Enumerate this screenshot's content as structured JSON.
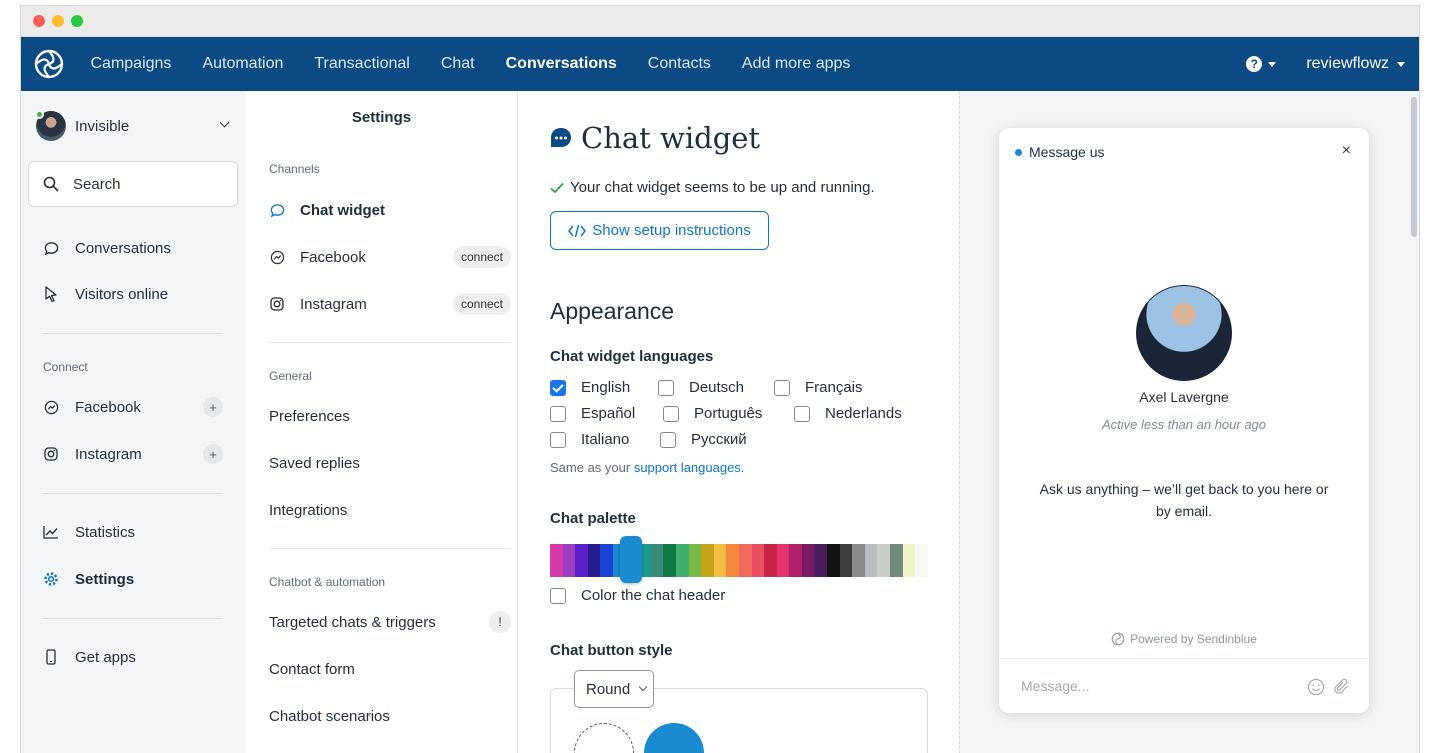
{
  "topnav": {
    "items": [
      {
        "label": "Campaigns",
        "active": false
      },
      {
        "label": "Automation",
        "active": false
      },
      {
        "label": "Transactional",
        "active": false
      },
      {
        "label": "Chat",
        "active": false
      },
      {
        "label": "Conversations",
        "active": true
      },
      {
        "label": "Contacts",
        "active": false
      },
      {
        "label": "Add more apps",
        "active": false
      }
    ],
    "help_symbol": "?",
    "account": "reviewflowz"
  },
  "sidebar": {
    "user_status": "Invisible",
    "search_label": "Search",
    "items": [
      {
        "label": "Conversations",
        "icon": "chat-bubble-icon"
      },
      {
        "label": "Visitors online",
        "icon": "cursor-icon"
      }
    ],
    "connect_section": "Connect",
    "connect_items": [
      {
        "label": "Facebook",
        "icon": "messenger-icon",
        "action": "+"
      },
      {
        "label": "Instagram",
        "icon": "instagram-icon",
        "action": "+"
      }
    ],
    "bottom_items": [
      {
        "label": "Statistics",
        "icon": "chart-icon"
      },
      {
        "label": "Settings",
        "icon": "gear-icon",
        "active": true
      }
    ],
    "get_apps": "Get apps"
  },
  "settings": {
    "title": "Settings",
    "channels_section": "Channels",
    "channels": [
      {
        "label": "Chat widget",
        "active": true
      },
      {
        "label": "Facebook",
        "badge": "connect"
      },
      {
        "label": "Instagram",
        "badge": "connect"
      }
    ],
    "general_section": "General",
    "general": [
      "Preferences",
      "Saved replies",
      "Integrations"
    ],
    "chatbot_section": "Chatbot & automation",
    "chatbot": [
      {
        "label": "Targeted chats & triggers",
        "badge": "!"
      },
      {
        "label": "Contact form"
      },
      {
        "label": "Chatbot scenarios"
      }
    ]
  },
  "main": {
    "title": "Chat widget",
    "status": "Your chat widget seems to be up and running.",
    "setup_button": "Show setup instructions",
    "appearance": "Appearance",
    "languages_heading": "Chat widget languages",
    "languages": [
      [
        {
          "name": "English",
          "checked": true
        },
        {
          "name": "Deutsch",
          "checked": false
        },
        {
          "name": "Français",
          "checked": false
        }
      ],
      [
        {
          "name": "Español",
          "checked": false
        },
        {
          "name": "Português",
          "checked": false
        },
        {
          "name": "Nederlands",
          "checked": false
        }
      ],
      [
        {
          "name": "Italiano",
          "checked": false
        },
        {
          "name": "Русский",
          "checked": false
        }
      ]
    ],
    "languages_note_prefix": "Same as your ",
    "languages_note_link": "support languages.",
    "palette_heading": "Chat palette",
    "palette_colors": [
      "#d63aa8",
      "#9b3fc2",
      "#5a1fc9",
      "#271c8c",
      "#1c44d4",
      "#1a8bd0",
      "#1ba5b9",
      "#1a9a8d",
      "#3a8c7a",
      "#107a47",
      "#3fae6a",
      "#7ab848",
      "#c4a316",
      "#f5bd42",
      "#f58a3c",
      "#f06a5e",
      "#e84d60",
      "#c8234a",
      "#e5336e",
      "#b21f6a",
      "#7a1c64",
      "#4b1d5c",
      "#121212",
      "#3e3e3e",
      "#8a8a8a",
      "#b8bcbc",
      "#c9cfc8",
      "#6f8b7b",
      "#eef4c8",
      "#f7faf4"
    ],
    "palette_selected_index": 5,
    "color_header_label": "Color the chat header",
    "button_style_heading": "Chat button style",
    "button_style_value": "Round"
  },
  "widget": {
    "header": "Message us",
    "close": "×",
    "agent_name": "Axel Lavergne",
    "agent_status": "Active less than an hour ago",
    "ask": "Ask us anything – we’ll get back to you here or by email.",
    "powered": "Powered by Sendinblue",
    "input_placeholder": "Message..."
  },
  "colors": {
    "nav_bg": "#0b4a82",
    "accent": "#0b76c7",
    "widget_blue": "#1a8bd0"
  }
}
